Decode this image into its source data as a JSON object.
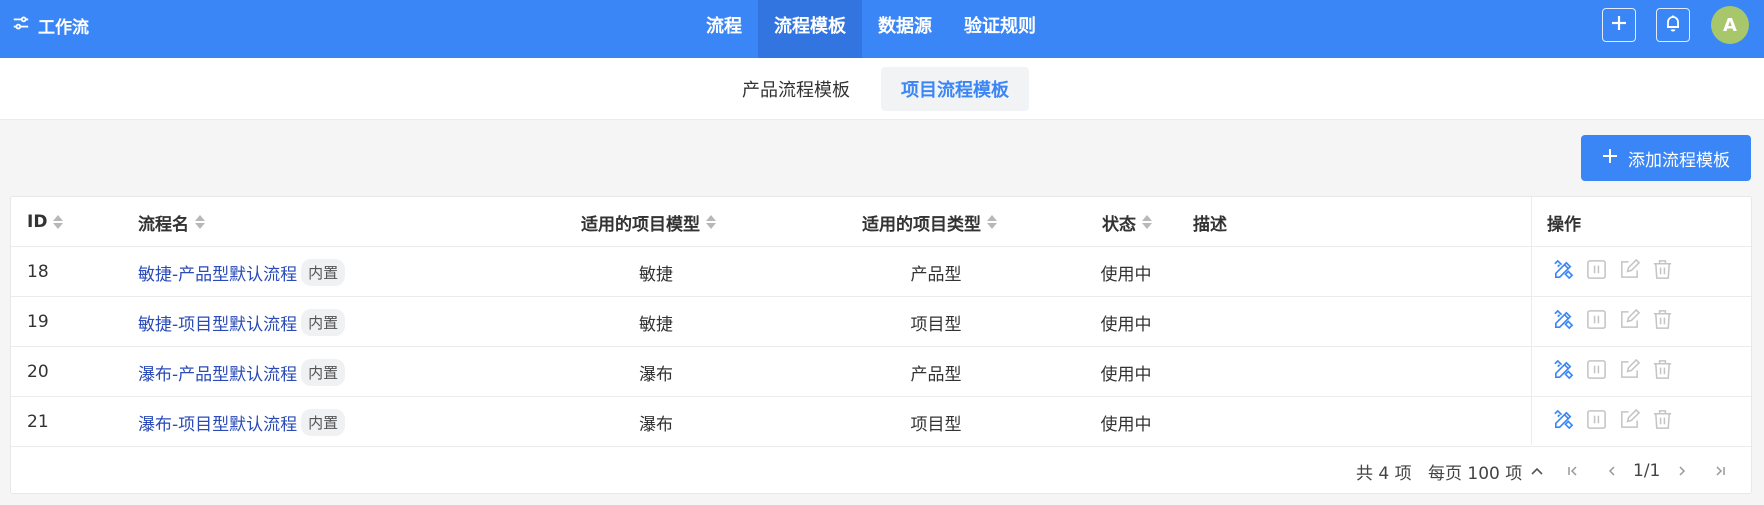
{
  "header": {
    "app_title": "工作流",
    "nav": [
      {
        "label": "流程",
        "active": false
      },
      {
        "label": "流程模板",
        "active": true
      },
      {
        "label": "数据源",
        "active": false
      },
      {
        "label": "验证规则",
        "active": false
      }
    ],
    "avatar_letter": "A",
    "icons": [
      "plus-icon",
      "bell-icon"
    ]
  },
  "subtabs": [
    {
      "label": "产品流程模板",
      "active": false
    },
    {
      "label": "项目流程模板",
      "active": true
    }
  ],
  "toolbar": {
    "add_label": "添加流程模板"
  },
  "table": {
    "columns": {
      "id": "ID",
      "name": "流程名",
      "model": "适用的项目模型",
      "type": "适用的项目类型",
      "status": "状态",
      "desc": "描述",
      "ops": "操作"
    },
    "rows": [
      {
        "id": "18",
        "name": "敏捷-产品型默认流程",
        "tag": "内置",
        "model": "敏捷",
        "type": "产品型",
        "status": "使用中",
        "desc": ""
      },
      {
        "id": "19",
        "name": "敏捷-项目型默认流程",
        "tag": "内置",
        "model": "敏捷",
        "type": "项目型",
        "status": "使用中",
        "desc": ""
      },
      {
        "id": "20",
        "name": "瀑布-产品型默认流程",
        "tag": "内置",
        "model": "瀑布",
        "type": "产品型",
        "status": "使用中",
        "desc": ""
      },
      {
        "id": "21",
        "name": "瀑布-项目型默认流程",
        "tag": "内置",
        "model": "瀑布",
        "type": "项目型",
        "status": "使用中",
        "desc": ""
      }
    ]
  },
  "pagination": {
    "total": "共 4 项",
    "per_page": "每页 100 项",
    "page": "1/1"
  },
  "colors": {
    "primary": "#3b86f6",
    "link": "#2a4bb8",
    "design_icon": "#3b86f6",
    "muted_icon": "#c4c4c4"
  }
}
